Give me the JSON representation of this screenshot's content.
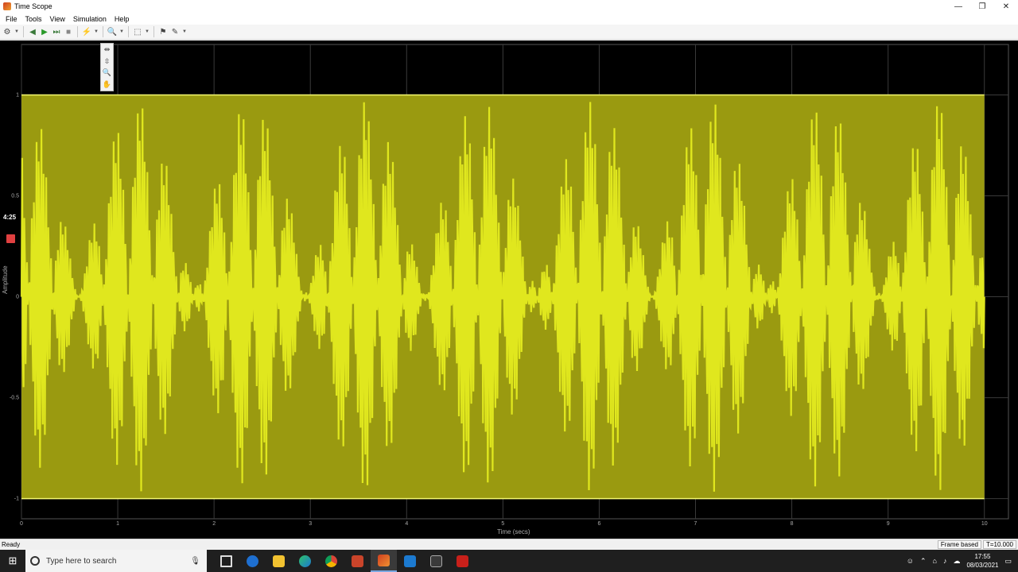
{
  "window": {
    "title": "Time Scope",
    "controls": [
      "—",
      "❐",
      "✕"
    ]
  },
  "menu": [
    "File",
    "Tools",
    "View",
    "Simulation",
    "Help"
  ],
  "toolbar": {
    "items": [
      "settings-icon",
      "step-back-icon",
      "run-icon",
      "step-forward-icon",
      "stop-icon",
      "highlight-icon",
      "zoom-in-icon",
      "autoscale-icon",
      "measurement-icon",
      "style-icon"
    ]
  },
  "zoom_menu": {
    "items": [
      "zoom-x-icon",
      "zoom-y-icon",
      "zoom-in-icon",
      "pan-icon"
    ]
  },
  "overlay": {
    "time": "4:25"
  },
  "chart_data": {
    "type": "line",
    "xlabel": "Time (secs)",
    "ylabel": "Amplitude",
    "xlim": [
      0,
      10.25
    ],
    "ylim": [
      -1.1,
      1.25
    ],
    "x_ticks": [
      "0",
      "1",
      "2",
      "3",
      "4",
      "5",
      "6",
      "7",
      "8",
      "9",
      "10"
    ],
    "y_ticks": [
      "1",
      "0.5",
      "0",
      "-0.5",
      "-1"
    ],
    "grid": true,
    "series": [
      {
        "color": "#e8f020",
        "amplitude": 1.0,
        "description_values": {
          "min": -1.0,
          "max": 1.0
        }
      }
    ],
    "background": "#000000"
  },
  "status": {
    "left": "Ready",
    "mode": "Frame based",
    "time": "T=10.000"
  },
  "taskbar": {
    "search_placeholder": "Type here to search",
    "time": "17:55",
    "date": "08/03/2021"
  }
}
